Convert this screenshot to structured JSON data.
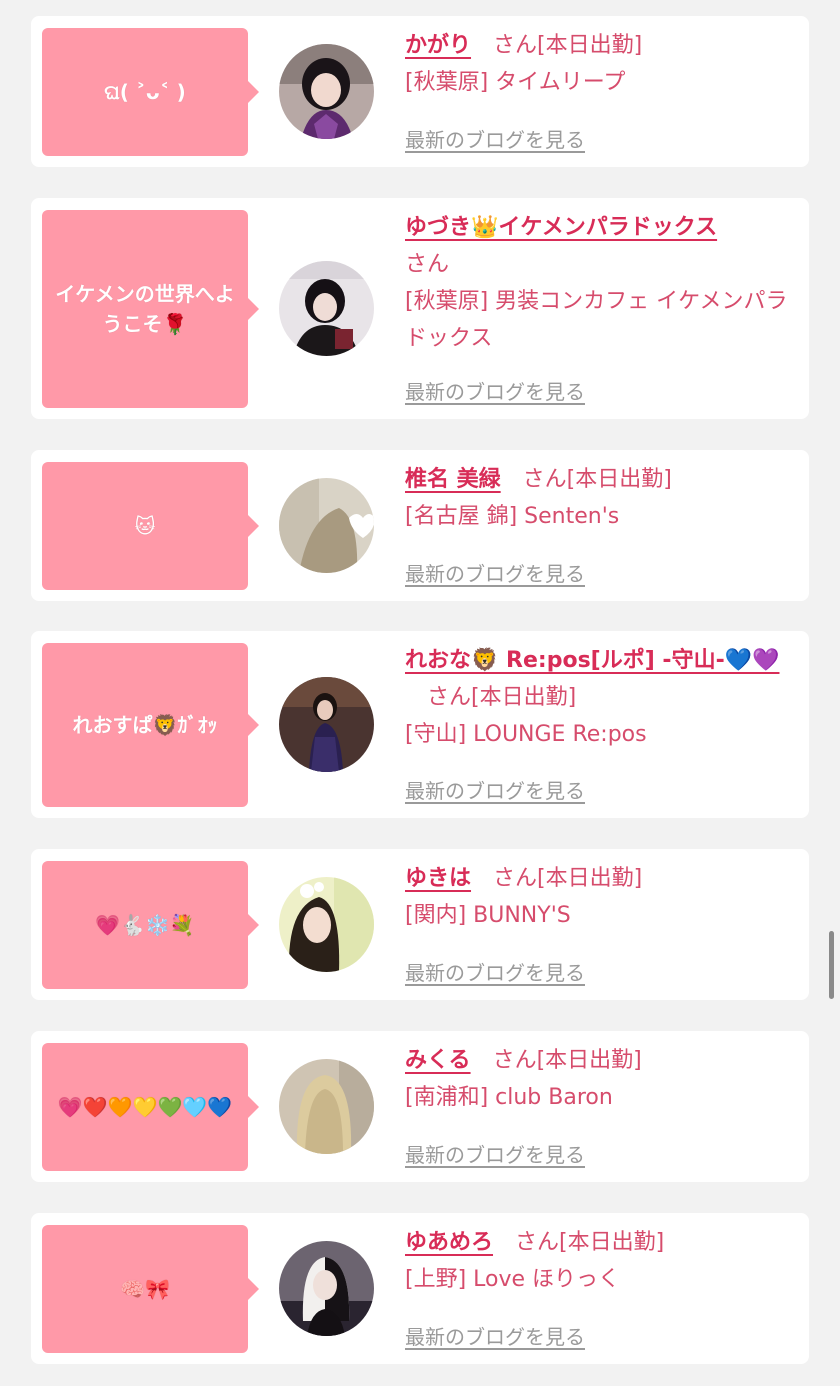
{
  "blog_link_label": "最新のブログを見る",
  "colors": {
    "bubble": "#ff99a8",
    "name": "#d82c57",
    "info_text": "#d64c6c",
    "link": "#9a9a9a",
    "page_bg": "#f2f2f2"
  },
  "entries": [
    {
      "bubble_text": "ଘ( ˃ᴗ˂ )",
      "name": "かがり",
      "suffix": "さん[本日出勤]",
      "shop": "[秋葉原] タイムリープ"
    },
    {
      "bubble_text": "イケメンの世界へようこそ🌹",
      "name": "ゆづき👑イケメンパラドックス",
      "suffix": "さん",
      "shop": "[秋葉原] 男装コンカフェ イケメンパラドックス"
    },
    {
      "bubble_text": "🐱",
      "name": "椎名 美緑",
      "suffix": "さん[本日出勤]",
      "shop": "[名古屋 錦] Senten's"
    },
    {
      "bubble_text": "れおすぱ🦁ｶﾞｵｯ",
      "name": "れおな🦁 Re:pos[ルポ] -守山-💙💜",
      "suffix": "さん[本日出勤]",
      "shop": "[守山] LOUNGE Re:pos"
    },
    {
      "bubble_text": "💗🐇❄️💐",
      "name": "ゆきは",
      "suffix": "さん[本日出勤]",
      "shop": "[関内] BUNNY'S"
    },
    {
      "bubble_text": "💗❤️🧡💛💚🩵💙",
      "name": "みくる",
      "suffix": "さん[本日出勤]",
      "shop": "[南浦和] club Baron"
    },
    {
      "bubble_text": "🧠🎀",
      "name": "ゆあめろ",
      "suffix": "さん[本日出勤]",
      "shop": "[上野] Love ほりっく"
    }
  ]
}
